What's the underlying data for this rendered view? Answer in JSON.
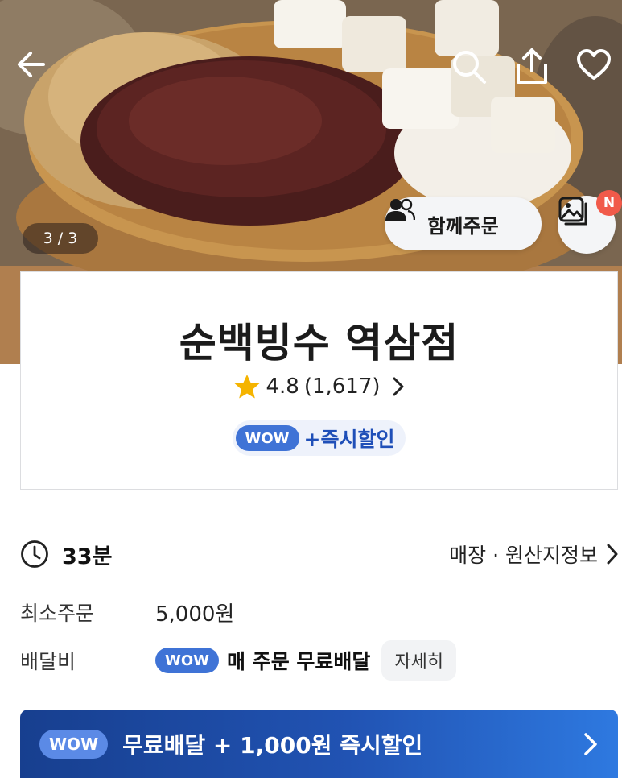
{
  "hero": {
    "page_indicator": "3 / 3",
    "group_order_label": "함께주문",
    "new_badge": "N",
    "icons": [
      "back-arrow-icon",
      "search-icon",
      "share-icon",
      "heart-icon",
      "group-icon",
      "photo-icon"
    ]
  },
  "store": {
    "name": "순백빙수 역삼점",
    "rating": "4.8",
    "review_count": "(1,617)",
    "wow_label": "WOW",
    "instant_discount": "+즉시할인"
  },
  "info": {
    "delivery_time": "33분",
    "store_info_link": "매장 · 원산지정보",
    "min_order_label": "최소주문",
    "min_order_value": "5,000원",
    "delivery_fee_label": "배달비",
    "wow_label": "WOW",
    "delivery_fee_value": "매 주문 무료배달",
    "detail_button": "자세히"
  },
  "promo": {
    "wow_label": "WOW",
    "text": "무료배달 + 1,000원 즉시할인"
  },
  "colors": {
    "accent_blue": "#3f73d6",
    "banner_blue": "#2153b3",
    "badge_red": "#f15a4a",
    "star_yellow": "#f5b400"
  }
}
